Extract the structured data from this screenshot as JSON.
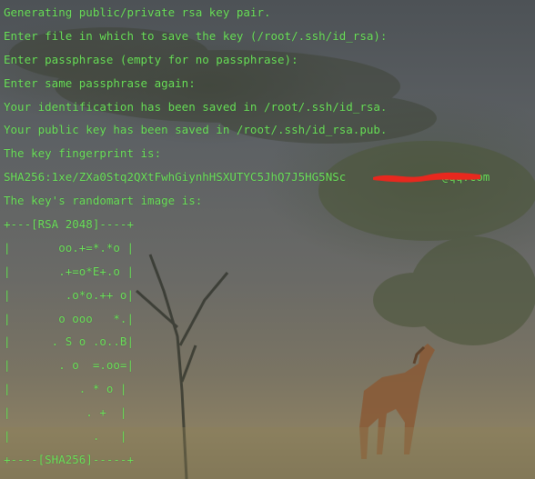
{
  "terminal": {
    "lines": [
      "Generating public/private rsa key pair.",
      "Enter file in which to save the key (/root/.ssh/id_rsa):",
      "Enter passphrase (empty for no passphrase):",
      "Enter same passphrase again:",
      "Your identification has been saved in /root/.ssh/id_rsa.",
      "Your public key has been saved in /root/.ssh/id_rsa.pub.",
      "The key fingerprint is:",
      "SHA256:1xe/ZXa0Stq2QXtFwhGiynhHSXUTYC5JhQ7J5HG5NSc              @qq.com",
      "The key's randomart image is:",
      "+---[RSA 2048]----+",
      "|       oo.+=*.*o |",
      "|       .+=o*E+.o |",
      "|        .o*o.++ o|",
      "|       o ooo   *.|",
      "|      . S o .o..B|",
      "|       . o  =.oo=|",
      "|          . * o |",
      "|           . +  |",
      "|            .   |",
      "+----[SHA256]-----+"
    ]
  },
  "colors": {
    "text": "#6be35a",
    "redaction": "#e8281e"
  }
}
